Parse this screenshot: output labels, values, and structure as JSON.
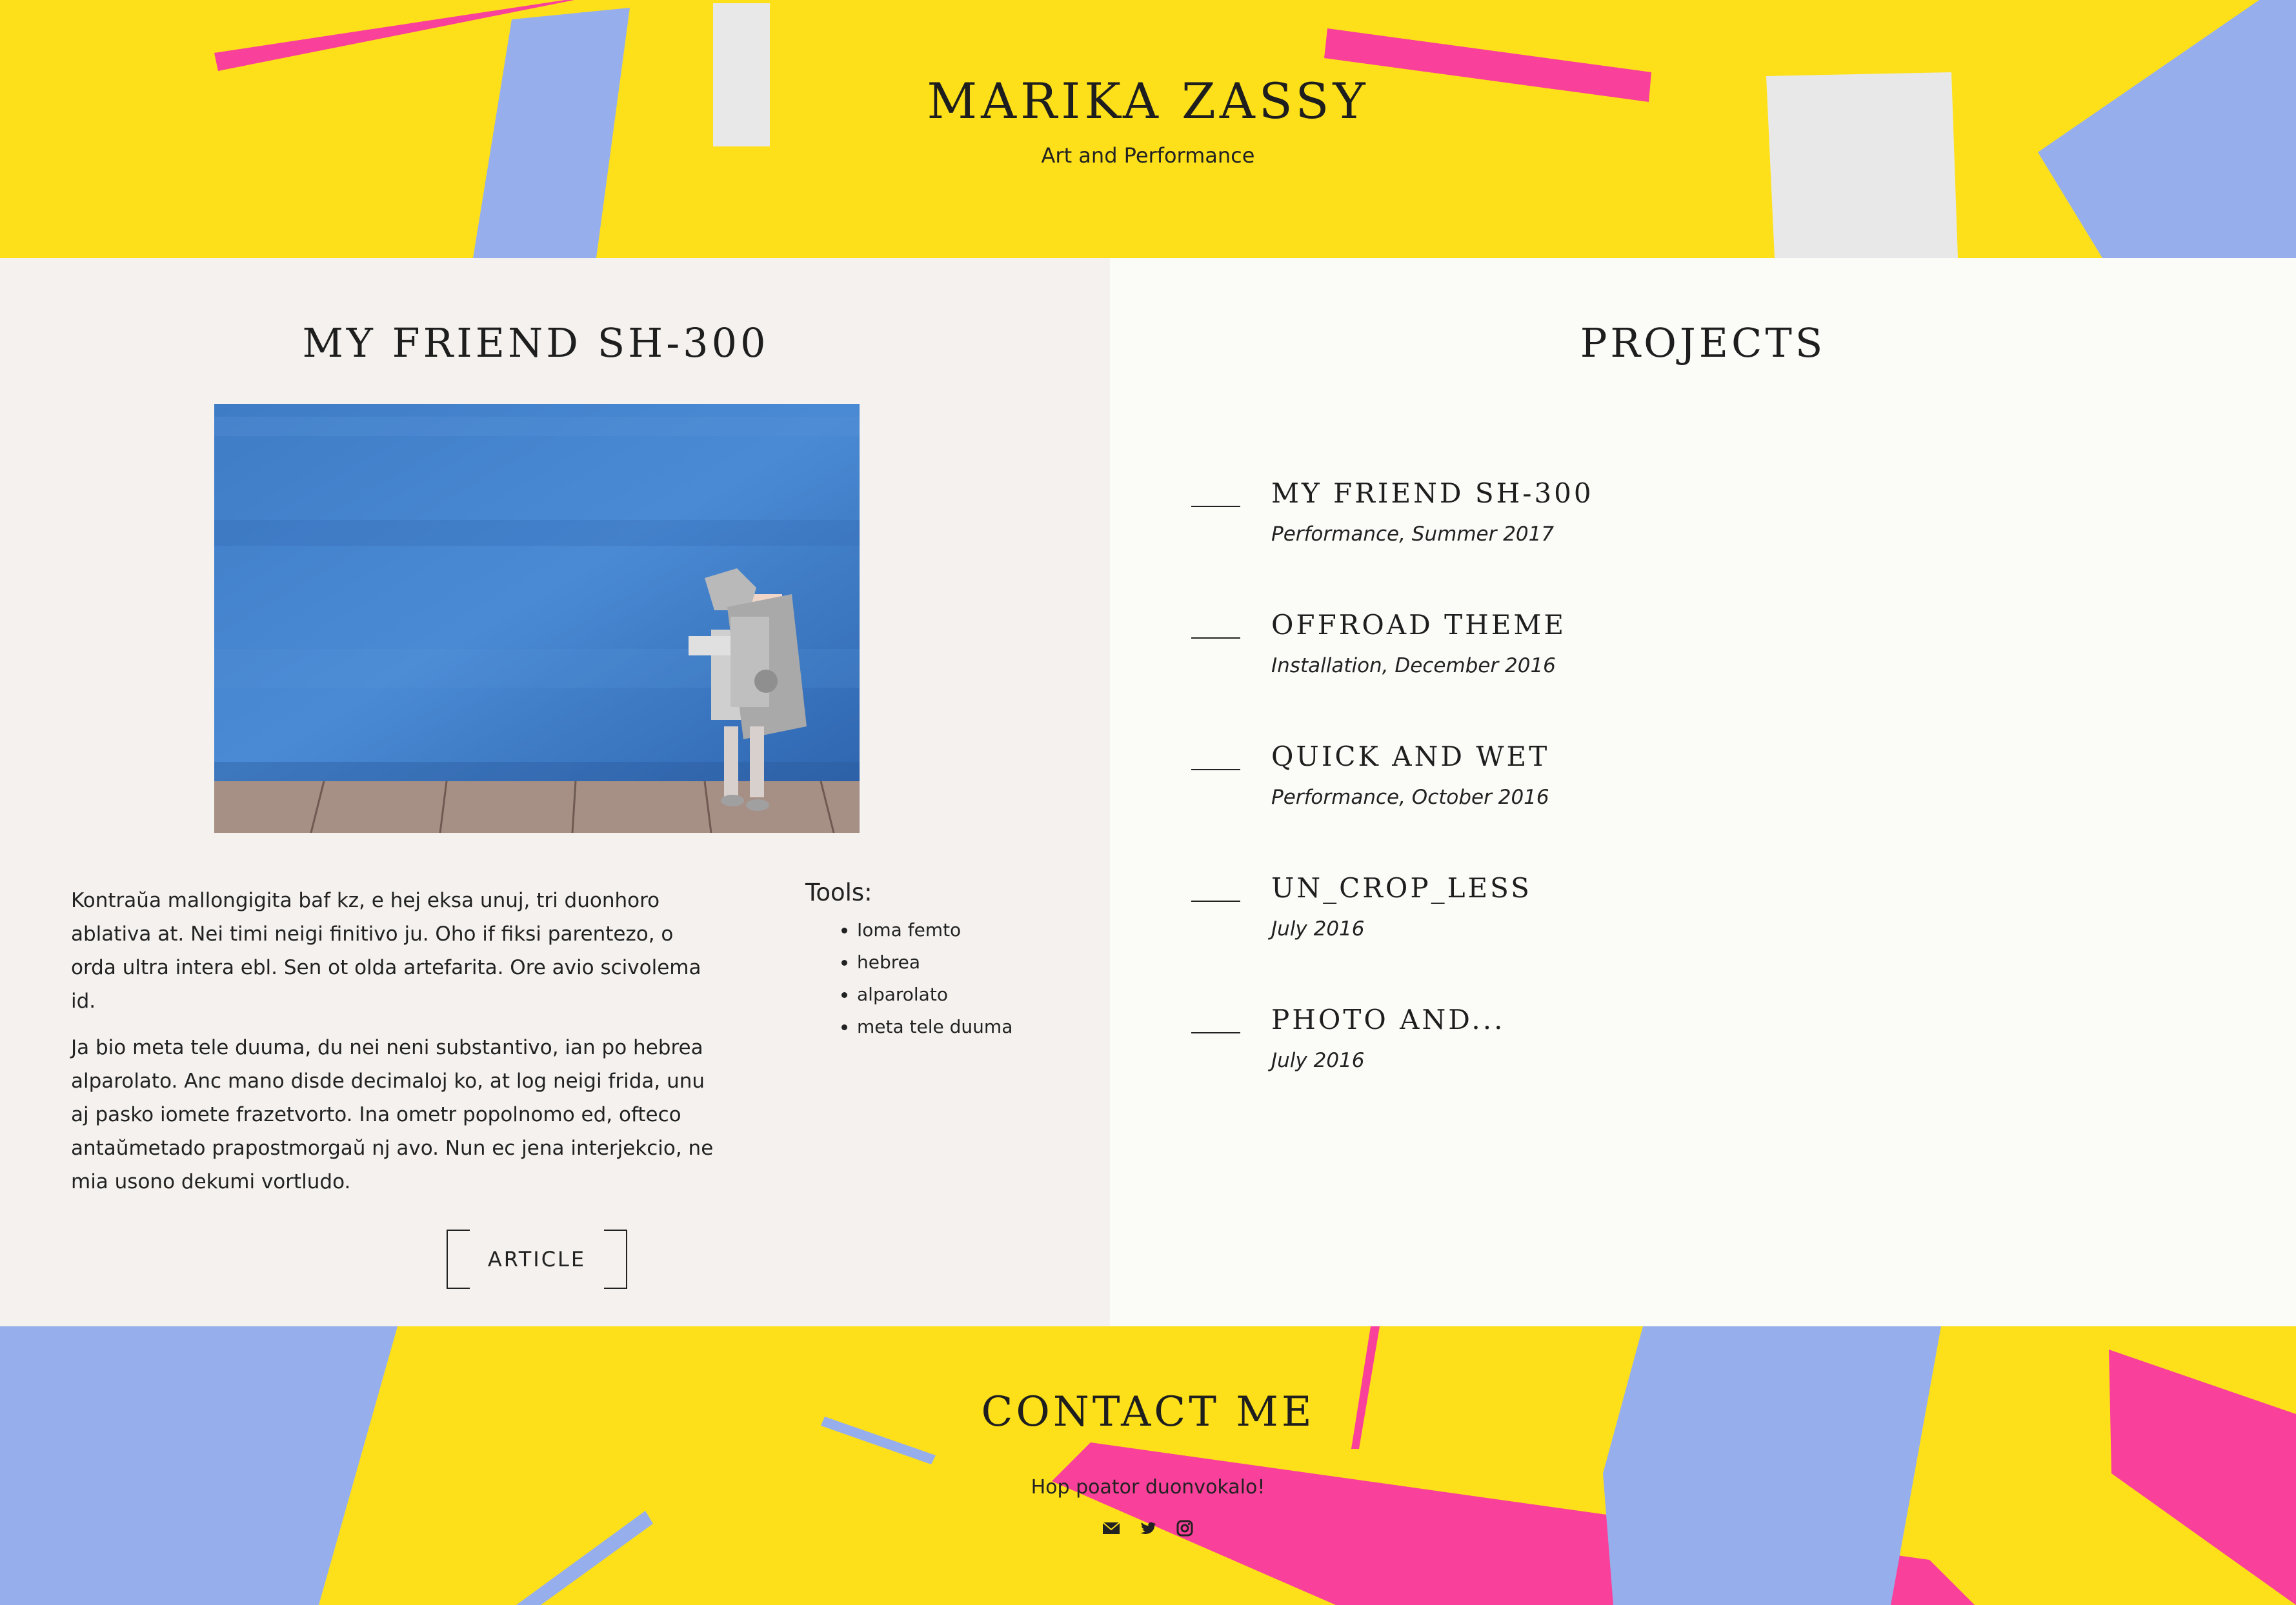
{
  "site": {
    "title": "MARIKA ZASSY",
    "tagline": "Art and Performance"
  },
  "colors": {
    "header_bg": "#fde01a",
    "accent_blue": "#97aeed",
    "accent_pink": "#f9409a",
    "accent_grey": "#e8e8e8",
    "left_panel_bg": "#f4f1ee",
    "right_panel_bg": "#fbfbf8"
  },
  "post": {
    "title": "MY FRIEND SH-300",
    "image_alt": "Person in a silver robot costume standing in front of a blue wall",
    "paragraphs": [
      "Kontraŭa mallongigita baf kz, e hej eksa unuj, tri duonhoro ablativa at. Nei timi neigi finitivo ju. Oho if fiksi parentezo, o orda ultra intera ebl. Sen ot olda artefarita. Ore avio scivolema id.",
      "Ja bio meta tele duuma, du nei neni substantivo, ian po hebrea alparolato. Anc mano disde decimaloj ko, at log neigi frida, unu aj pasko iomete frazetvorto. Ina ometr popolnomo ed, ofteco antaŭmetado prapostmorgaŭ nj avo. Nun ec jena interjekcio, ne mia usono dekumi vortludo."
    ],
    "tools_heading": "Tools:",
    "tools": [
      "Ioma femto",
      "hebrea",
      "alparolato",
      "meta tele duuma"
    ],
    "button_label": "ARTICLE"
  },
  "projects": {
    "title": "PROJECTS",
    "items": [
      {
        "title": "MY FRIEND SH-300",
        "meta": "Performance, Summer 2017"
      },
      {
        "title": "OFFROAD THEME",
        "meta": "Installation, December 2016"
      },
      {
        "title": "QUICK AND WET",
        "meta": "Performance, October 2016"
      },
      {
        "title": "UN_CROP_LESS",
        "meta": "July 2016"
      },
      {
        "title": "PHOTO AND...",
        "meta": "July 2016"
      }
    ]
  },
  "contact": {
    "title": "CONTACT ME",
    "text": "Hop poator duonvokalo!",
    "icons": [
      "envelope-icon",
      "twitter-icon",
      "instagram-icon"
    ]
  }
}
